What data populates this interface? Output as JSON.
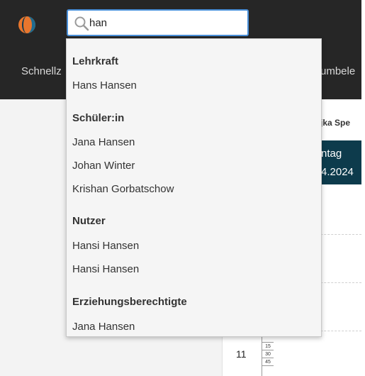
{
  "search": {
    "value": "han",
    "icon": "search-icon"
  },
  "logo": {
    "icon": "app-logo-icon",
    "colors": [
      "#e8762d",
      "#1f6b8f"
    ]
  },
  "nav": {
    "left_label": "Schnellz",
    "right_label": "umbele"
  },
  "background": {
    "teacher_name": "jka Spe",
    "day_line1": "ntag",
    "day_line2": "4.2024",
    "hour": "11",
    "quarters": [
      "15",
      "30",
      "45"
    ]
  },
  "dropdown": {
    "groups": [
      {
        "heading": "Lehrkraft",
        "items": [
          "Hans Hansen"
        ]
      },
      {
        "heading": "Schüler:in",
        "items": [
          "Jana Hansen",
          "Johan Winter",
          "Krishan Gorbatschow"
        ]
      },
      {
        "heading": "Nutzer",
        "items": [
          "Hansi Hansen",
          "Hansi Hansen"
        ]
      },
      {
        "heading": "Erziehungsberechtigte",
        "items": [
          "Jana Hansen"
        ]
      }
    ]
  },
  "colors": {
    "topbar": "#262626",
    "search_border": "#4a90d9",
    "day_header": "#0d3b4c"
  }
}
